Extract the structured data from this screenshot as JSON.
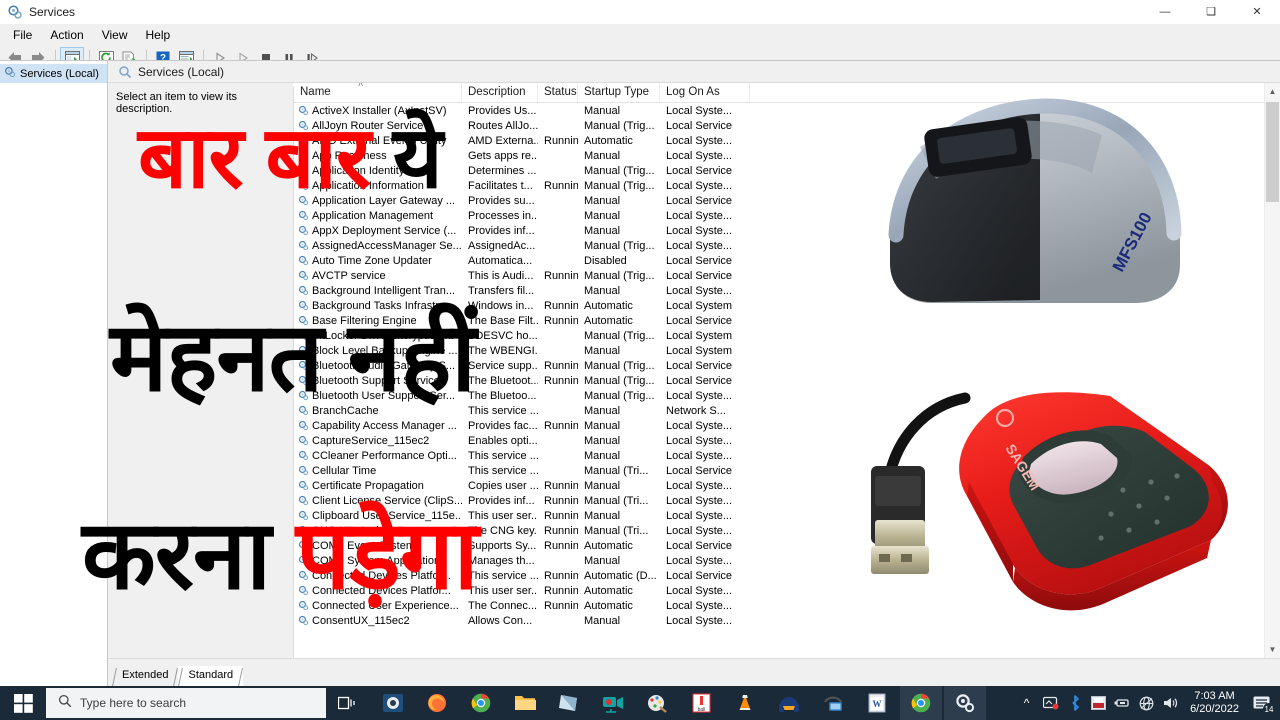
{
  "window": {
    "title": "Services",
    "icon": "services-gear-icon",
    "controls": {
      "minimize": "—",
      "restore": "❑",
      "close": "✕"
    }
  },
  "menubar": {
    "items": [
      "File",
      "Action",
      "View",
      "Help"
    ]
  },
  "toolbar": {
    "buttons": [
      "back-arrow-icon",
      "forward-arrow-icon",
      "show-hide-tree-icon",
      "refresh-icon",
      "export-list-icon",
      "help-icon",
      "properties-icon",
      "start-service-icon",
      "resume-service-icon",
      "stop-service-icon",
      "pause-service-icon",
      "restart-service-icon"
    ]
  },
  "tree": {
    "root_label": "Services (Local)"
  },
  "pane": {
    "header_title": "Services (Local)",
    "description_prompt": "Select an item to view its description."
  },
  "list": {
    "columns": [
      "Name",
      "Description",
      "Status",
      "Startup Type",
      "Log On As"
    ],
    "sort_indicator": "˄",
    "rows": [
      {
        "name": "ActiveX Installer (AxInstSV)",
        "description": "Provides Us...",
        "status": "",
        "startup": "Manual",
        "logon": "Local Syste..."
      },
      {
        "name": "AllJoyn Router Service",
        "description": "Routes AllJo...",
        "status": "",
        "startup": "Manual (Trig...",
        "logon": "Local Service"
      },
      {
        "name": "AMD External Events Utility",
        "description": "AMD Externa...",
        "status": "Running",
        "startup": "Automatic",
        "logon": "Local Syste..."
      },
      {
        "name": "App Readiness",
        "description": "Gets apps re...",
        "status": "",
        "startup": "Manual",
        "logon": "Local Syste..."
      },
      {
        "name": "Application Identity",
        "description": "Determines ...",
        "status": "",
        "startup": "Manual (Trig...",
        "logon": "Local Service"
      },
      {
        "name": "Application Information",
        "description": "Facilitates t...",
        "status": "Running",
        "startup": "Manual (Trig...",
        "logon": "Local Syste..."
      },
      {
        "name": "Application Layer Gateway ...",
        "description": "Provides su...",
        "status": "",
        "startup": "Manual",
        "logon": "Local Service"
      },
      {
        "name": "Application Management",
        "description": "Processes in...",
        "status": "",
        "startup": "Manual",
        "logon": "Local Syste..."
      },
      {
        "name": "AppX Deployment Service (...",
        "description": "Provides inf...",
        "status": "",
        "startup": "Manual",
        "logon": "Local Syste..."
      },
      {
        "name": "AssignedAccessManager Se...",
        "description": "AssignedAc...",
        "status": "",
        "startup": "Manual (Trig...",
        "logon": "Local Syste..."
      },
      {
        "name": "Auto Time Zone Updater",
        "description": "Automatica...",
        "status": "",
        "startup": "Disabled",
        "logon": "Local Service"
      },
      {
        "name": "AVCTP service",
        "description": "This is Audi...",
        "status": "Running",
        "startup": "Manual (Trig...",
        "logon": "Local Service"
      },
      {
        "name": "Background Intelligent Tran...",
        "description": "Transfers fil...",
        "status": "",
        "startup": "Manual",
        "logon": "Local Syste..."
      },
      {
        "name": "Background Tasks Infrastruc...",
        "description": "Windows in...",
        "status": "Running",
        "startup": "Automatic",
        "logon": "Local System"
      },
      {
        "name": "Base Filtering Engine",
        "description": "The Base Filt...",
        "status": "Running",
        "startup": "Automatic",
        "logon": "Local Service"
      },
      {
        "name": "BitLocker Drive Encryption ...",
        "description": "BDESVC ho...",
        "status": "",
        "startup": "Manual (Trig...",
        "logon": "Local System"
      },
      {
        "name": "Block Level Backup Engine ...",
        "description": "The WBENGI...",
        "status": "",
        "startup": "Manual",
        "logon": "Local System"
      },
      {
        "name": "Bluetooth Audio Gateway S...",
        "description": "Service supp...",
        "status": "Running",
        "startup": "Manual (Trig...",
        "logon": "Local Service"
      },
      {
        "name": "Bluetooth Support Service",
        "description": "The Bluetoot...",
        "status": "Running",
        "startup": "Manual (Trig...",
        "logon": "Local Service"
      },
      {
        "name": "Bluetooth User Support Ser...",
        "description": "The Bluetoo...",
        "status": "",
        "startup": "Manual (Trig...",
        "logon": "Local Syste..."
      },
      {
        "name": "BranchCache",
        "description": "This service ...",
        "status": "",
        "startup": "Manual",
        "logon": "Network S..."
      },
      {
        "name": "Capability Access Manager ...",
        "description": "Provides fac...",
        "status": "Running",
        "startup": "Manual",
        "logon": "Local Syste..."
      },
      {
        "name": "CaptureService_115ec2",
        "description": "Enables opti...",
        "status": "",
        "startup": "Manual",
        "logon": "Local Syste..."
      },
      {
        "name": "CCleaner Performance Opti...",
        "description": "This service ...",
        "status": "",
        "startup": "Manual",
        "logon": "Local Syste..."
      },
      {
        "name": "Cellular Time",
        "description": "This service ...",
        "status": "",
        "startup": "Manual (Tri...",
        "logon": "Local Service"
      },
      {
        "name": "Certificate Propagation",
        "description": "Copies user ...",
        "status": "Running",
        "startup": "Manual",
        "logon": "Local Syste..."
      },
      {
        "name": "Client License Service (ClipS...",
        "description": "Provides inf...",
        "status": "Running",
        "startup": "Manual (Tri...",
        "logon": "Local Syste..."
      },
      {
        "name": "Clipboard User Service_115e...",
        "description": "This user ser...",
        "status": "Running",
        "startup": "Manual",
        "logon": "Local Syste..."
      },
      {
        "name": "CNG Key Isolation",
        "description": "The CNG key...",
        "status": "Running",
        "startup": "Manual (Tri...",
        "logon": "Local Syste..."
      },
      {
        "name": "COM+ Event System",
        "description": "Supports Sy...",
        "status": "Running",
        "startup": "Automatic",
        "logon": "Local Service"
      },
      {
        "name": "COM+ System Application",
        "description": "Manages th...",
        "status": "",
        "startup": "Manual",
        "logon": "Local Syste..."
      },
      {
        "name": "Connected Devices Platfor...",
        "description": "This service ...",
        "status": "Running",
        "startup": "Automatic (D...",
        "logon": "Local Service"
      },
      {
        "name": "Connected Devices Platfor...",
        "description": "This user ser...",
        "status": "Running",
        "startup": "Automatic",
        "logon": "Local Syste..."
      },
      {
        "name": "Connected User Experience...",
        "description": "The Connec...",
        "status": "Running",
        "startup": "Automatic",
        "logon": "Local Syste..."
      },
      {
        "name": "ConsentUX_115ec2",
        "description": "Allows Con...",
        "status": "",
        "startup": "Manual",
        "logon": "Local Syste..."
      }
    ]
  },
  "bottom_tabs": {
    "items": [
      "Extended",
      "Standard"
    ],
    "active": "Standard"
  },
  "overlay_text": {
    "line1_red": "बार बार",
    "line1_black": "ये",
    "line2_black": "मेहनत नहीं",
    "line3_black": "करना",
    "line3_red": "पड़ेगा",
    "red_color": "#fe0000",
    "black_color": "#000000"
  },
  "devices": {
    "mfs100": {
      "label": "MFS100",
      "name": "fingerprint-scanner-mfs100"
    },
    "sagem": {
      "label": "SAGEM",
      "name": "fingerprint-scanner-sagem"
    }
  },
  "taskbar": {
    "start": "windows-start-icon",
    "search_placeholder": "Type here to search",
    "search_icon": "search-icon",
    "taskview": "task-view-icon",
    "apps": [
      "media-player-icon",
      "firefox-icon",
      "chrome-icon",
      "file-explorer-icon",
      "notepad-icon",
      "camera-recorder-icon",
      "paint-icon",
      "ball-app-icon",
      "vlc-icon",
      "audacity-icon",
      "remote-desktop-icon",
      "word-icon",
      "chrome-window-icon",
      "services-window-icon"
    ],
    "tray": {
      "chevron": "show-hidden-icons-icon",
      "icons": [
        "onedrive-icon",
        "bluetooth-icon",
        "screen-recorder-icon",
        "usb-device-icon",
        "network-icon",
        "volume-icon"
      ],
      "time": "7:03 AM",
      "date": "6/20/2022",
      "notification_count": "14"
    }
  }
}
